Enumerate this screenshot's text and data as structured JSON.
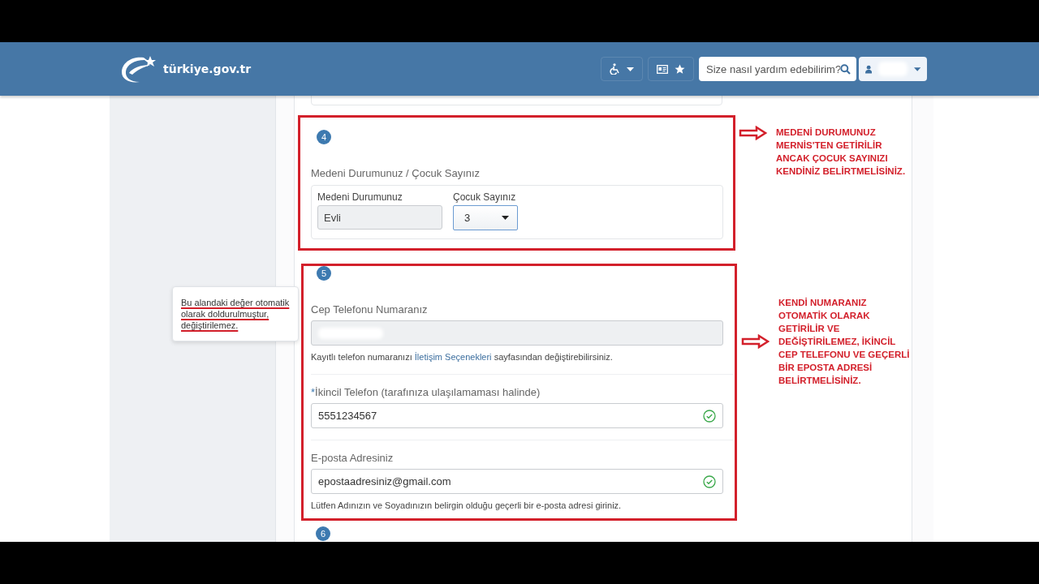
{
  "header": {
    "logo": "türkiye.gov.tr",
    "search": {
      "placeholder": "Size nasıl yardım edebilirim?"
    }
  },
  "sections": [
    {
      "number": "4",
      "highlighted": true,
      "title": "Medeni Durumunuz / Çocuk Sayınız",
      "fields": [
        {
          "kind": "readonly",
          "label": "Medeni Durumunuz",
          "value": "Evli"
        },
        {
          "kind": "select",
          "label": "Çocuk Sayınız",
          "value": "3"
        }
      ]
    },
    {
      "number": "5",
      "highlighted": true,
      "fields": [
        {
          "kind": "readonly",
          "label": "Cep Telefonu Numaranız",
          "help": {
            "before": "Kayıtlı telefon numaranızı",
            "link": "İletişim Seçenekleri",
            "after": "sayfasından değiştirebilirsiniz."
          }
        },
        {
          "kind": "text",
          "required_mark": "*",
          "label": "İkincil Telefon (tarafınıza ulaşılamaması halinde)",
          "value": "5551234567",
          "valid": true
        },
        {
          "kind": "text",
          "label": "E-posta Adresiniz",
          "value": "epostaadresiniz@gmail.com",
          "valid": true,
          "help": {
            "before": "Lütfen Adınızın ve Soyadınızın belirgin olduğu geçerli bir e-posta adresi giriniz."
          }
        }
      ]
    },
    {
      "number": "6",
      "highlighted": false
    }
  ],
  "tooltip": "Bu alandaki değer otomatik\nolarak doldurulmuştur,\ndeğiştirilemez.",
  "annotations": [
    {
      "text": "MEDENİ DURUMUNUZ\nMERNİS'TEN GETİRİLİR\nANCAK ÇOCUK SAYINIZI\nKENDİNİZ BELİRTMELİSİNİZ."
    },
    {
      "text": "KENDİ NUMARANIZ\nOTOMATİK OLARAK\nGETİRİLİR VE\nDEĞİŞTİRİLEMEZ, İKİNCİL\nCEP TELEFONU VE GEÇERLİ\nBİR EPOSTA ADRESİ\nBELİRTMELİSİNİZ."
    }
  ]
}
